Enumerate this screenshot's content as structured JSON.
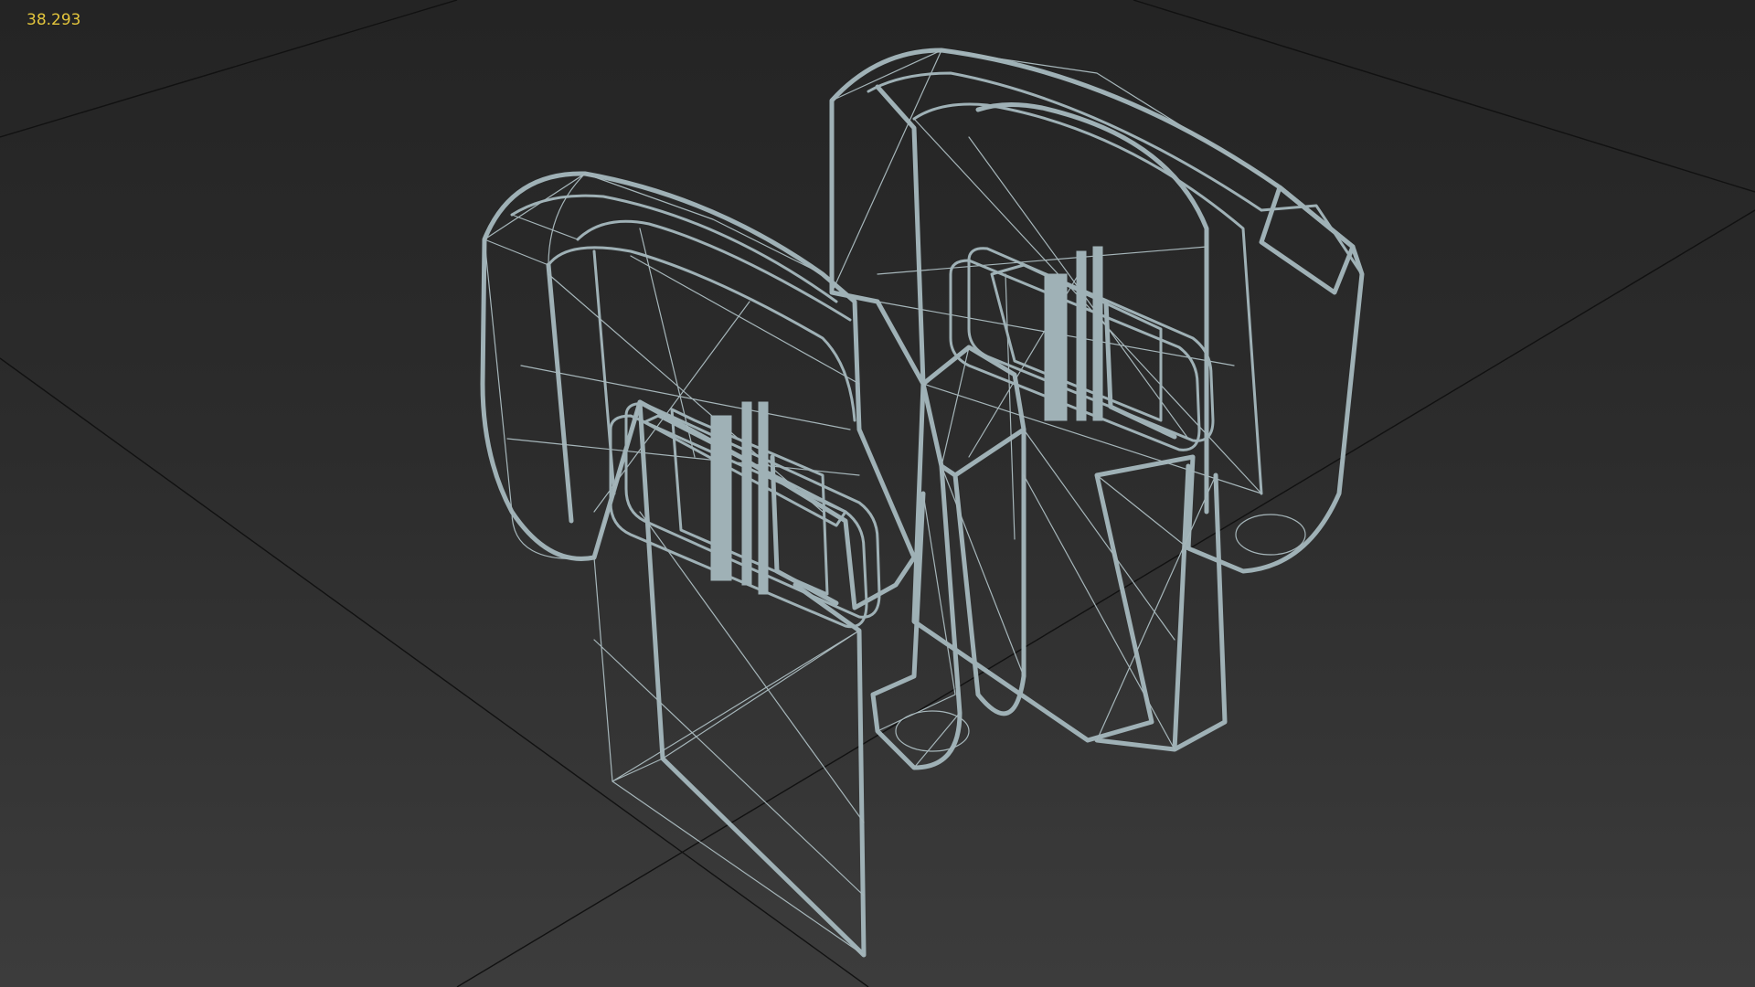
{
  "viewport": {
    "stat_value": "38.293",
    "stat_color": "#e3c53c",
    "background_color": "#2b2b2b",
    "wireframe_color": "#9fb1b6",
    "grid_color": "#111111"
  }
}
